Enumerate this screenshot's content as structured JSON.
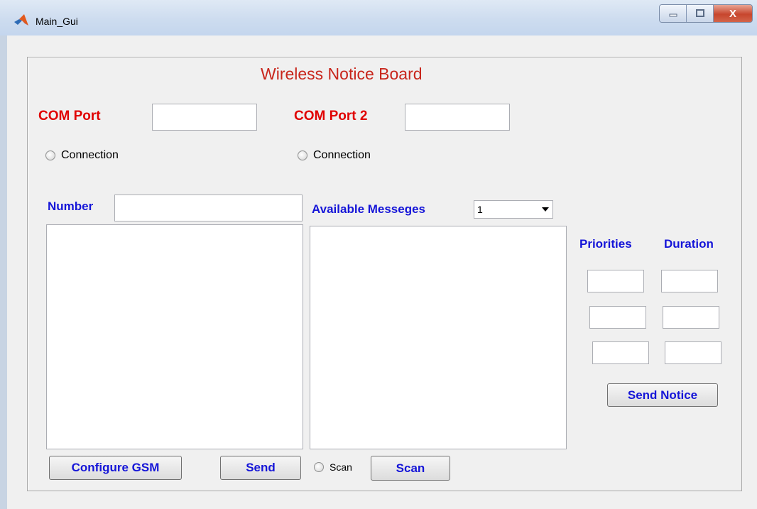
{
  "window": {
    "title": "Main_Gui",
    "controls": {
      "minimize": "–",
      "maximize": "□",
      "close": "X"
    }
  },
  "heading": "Wireless Notice Board",
  "com_port": {
    "label": "COM Port",
    "value": ""
  },
  "com_port2": {
    "label": "COM Port 2",
    "value": ""
  },
  "connection1": {
    "label": "Connection"
  },
  "connection2": {
    "label": "Connection"
  },
  "number": {
    "label": "Number",
    "value": ""
  },
  "messages": {
    "label": "Available Messeges",
    "selected": "1"
  },
  "priorities_label": "Priorities",
  "duration_label": "Duration",
  "buttons": {
    "configure": "Configure GSM",
    "send": "Send",
    "scan": "Scan",
    "send_notice": "Send Notice"
  },
  "scan_radio": {
    "label": "Scan"
  },
  "icons": {
    "app": "matlab-icon",
    "dropdown": "chevron-down-icon"
  },
  "colors": {
    "heading": "#c8261c",
    "red_label": "#e00000",
    "blue_label": "#1515d8"
  }
}
